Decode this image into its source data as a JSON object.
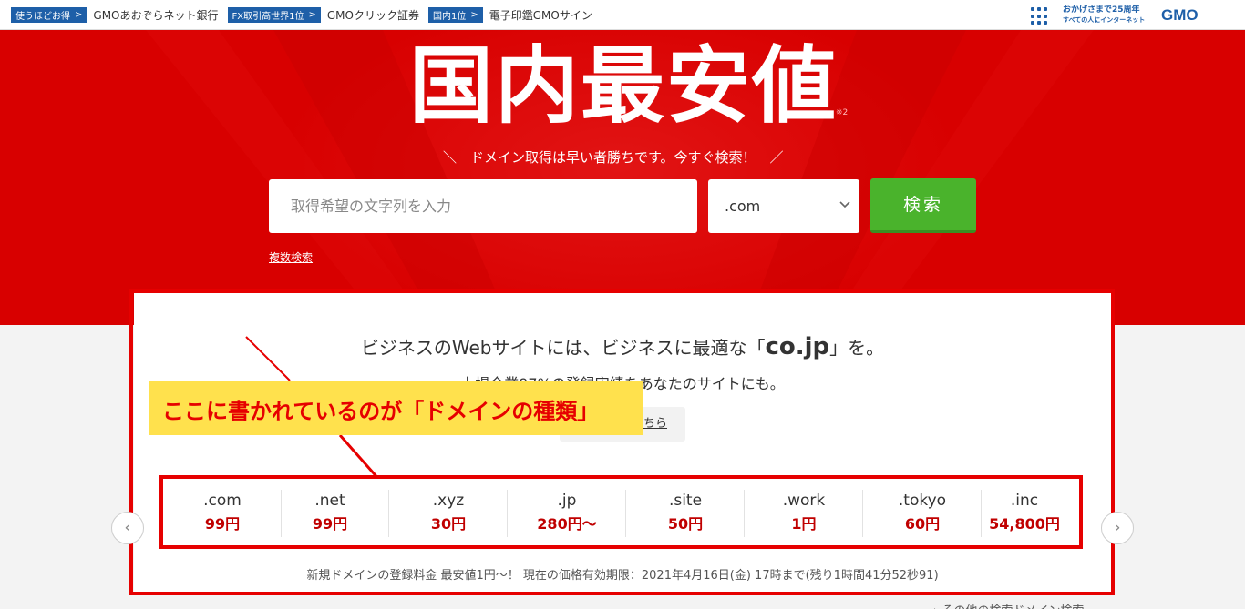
{
  "topbar": {
    "links": [
      {
        "tag": "使うほどお得",
        "text": "GMOあおぞらネット銀行"
      },
      {
        "tag": "FX取引高世界1位",
        "text": "GMOクリック証券"
      },
      {
        "tag": "国内1位",
        "text": "電子印鑑GMOサイン"
      }
    ],
    "tag_arrow": ">",
    "anniversary_line1": "おかげさまで25周年",
    "anniversary_line2": "すべての人にインターネット",
    "logo": "GMO"
  },
  "hero": {
    "title": "国内最安値",
    "title_note": "※2",
    "tagline": "＼　ドメイン取得は早い者勝ちです。今すぐ検索！　／",
    "search_placeholder": "取得希望の文字列を入力",
    "tld_selected": ".com",
    "search_button": "検索",
    "multi_search_link": "複数検索"
  },
  "card": {
    "biz_prefix": "ビジネスのWebサイトには、ビジネスに最適な「",
    "biz_domain": "co.jp",
    "biz_suffix": "」を。",
    "sub_line": "上場企業97%の登録実績をあなたのサイトにも。",
    "more_button": "ちら"
  },
  "annotation": {
    "text": "ここに書かれているのが「ドメインの種類」"
  },
  "tlds": [
    {
      "name": ".com",
      "price": "99円"
    },
    {
      "name": ".net",
      "price": "99円"
    },
    {
      "name": ".xyz",
      "price": "30円"
    },
    {
      "name": ".jp",
      "price": "280円〜"
    },
    {
      "name": ".site",
      "price": "50円"
    },
    {
      "name": ".work",
      "price": "1円"
    },
    {
      "name": ".tokyo",
      "price": "60円"
    },
    {
      "name": ".inc",
      "price": "54,800円"
    }
  ],
  "nav": {
    "prev": "‹",
    "next": "›"
  },
  "footnote": "新規ドメインの登録料金 最安値1円〜！ 現在の価格有効期限：2021年4月16日(金) 17時まで(残り1時間41分52秒91)",
  "other_search": "› その他の検索ドメイン検索",
  "colors": {
    "hero_red": "#d80000",
    "search_green": "#4ab32c",
    "price_red": "#c00000",
    "annotation_yellow": "#ffe14d",
    "annotation_border_red": "#e60000",
    "gmo_blue": "#1e5fa8"
  }
}
